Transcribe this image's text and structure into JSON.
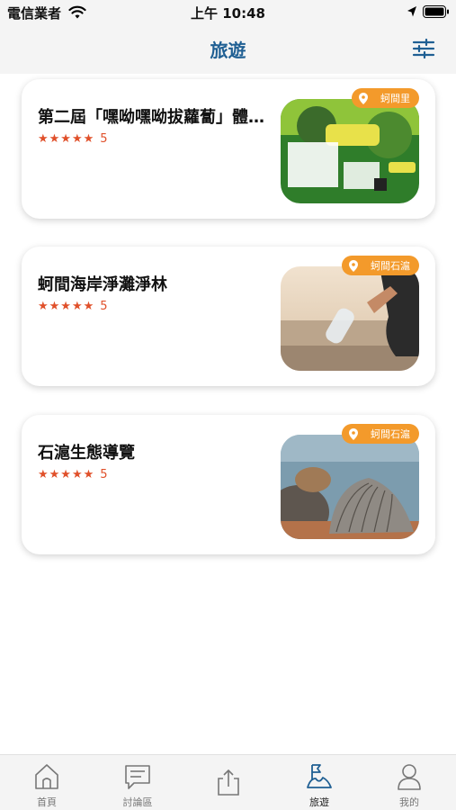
{
  "status_bar": {
    "carrier": "電信業者",
    "time": "上午 10:48",
    "icons": [
      "wifi-icon",
      "location-arrow-icon",
      "battery-icon"
    ]
  },
  "header": {
    "title": "旅遊",
    "filter_icon": "sliders-icon",
    "accent_color": "#1f5f93"
  },
  "cards": [
    {
      "title": "第二屆「嘿呦嘿呦拔蘿蔔」體驗活動",
      "stars": "★★★★★",
      "rating": "5",
      "location": "蚵間里",
      "image": "poster"
    },
    {
      "title": "蚵間海岸淨灘淨林",
      "stars": "★★★★★",
      "rating": "5",
      "location": "蚵間石滬",
      "image": "beach-cleanup"
    },
    {
      "title": "石滬生態導覽",
      "stars": "★★★★★",
      "rating": "5",
      "location": "蚵間石滬",
      "image": "oyster-shell"
    }
  ],
  "tab_bar": {
    "items": [
      {
        "label": "首頁",
        "icon": "home-icon"
      },
      {
        "label": "討論區",
        "icon": "chat-icon"
      },
      {
        "label": "",
        "icon": "share-icon"
      },
      {
        "label": "旅遊",
        "icon": "travel-flag-icon",
        "active": true
      },
      {
        "label": "我的",
        "icon": "user-icon"
      }
    ]
  },
  "colors": {
    "badge": "#f39a2b",
    "stars": "#e0502a"
  }
}
